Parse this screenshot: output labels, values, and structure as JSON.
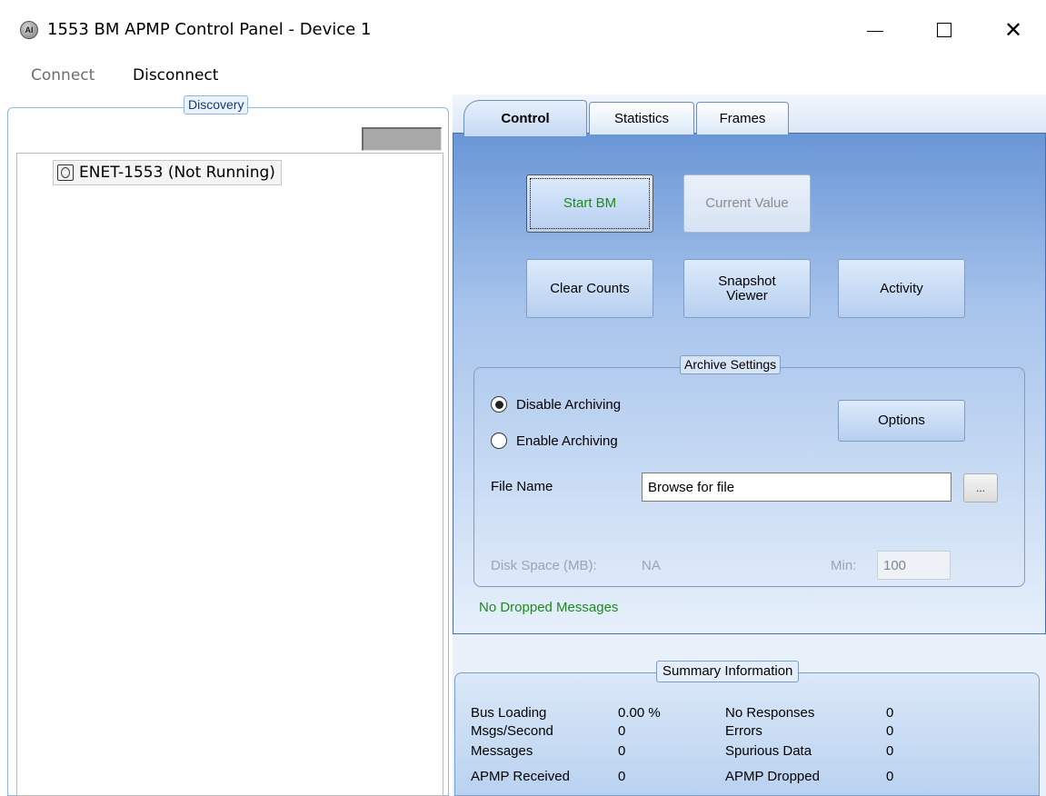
{
  "window": {
    "title": "1553 BM APMP Control Panel - Device 1",
    "icon_text": "AI"
  },
  "menu": {
    "connect": "Connect",
    "disconnect": "Disconnect"
  },
  "discovery": {
    "legend": "Discovery",
    "tree_items": [
      {
        "label": "ENET-1553 (Not Running)",
        "icon": "device-status-icon"
      }
    ]
  },
  "tabs": [
    {
      "label": "Control",
      "active": true
    },
    {
      "label": "Statistics",
      "active": false
    },
    {
      "label": "Frames",
      "active": false
    }
  ],
  "control": {
    "start_bm": "Start BM",
    "current_value": "Current Value",
    "clear_counts": "Clear Counts",
    "snapshot_viewer": "Snapshot Viewer",
    "activity": "Activity",
    "archive": {
      "legend": "Archive Settings",
      "disable_label": "Disable Archiving",
      "enable_label": "Enable Archiving",
      "selected": "Disable Archiving",
      "options": "Options",
      "file_name_label": "File Name",
      "file_name_value": "Browse for file",
      "browse": "...",
      "disk_space_label": "Disk Space (MB):",
      "disk_space_value": "NA",
      "min_label": "Min:",
      "min_value": "100"
    },
    "status": "No Dropped Messages"
  },
  "summary": {
    "legend": "Summary Information",
    "left": [
      {
        "label": "Bus Loading",
        "value": "0.00 %"
      },
      {
        "label": "Msgs/Second",
        "value": "0"
      },
      {
        "label": "Messages",
        "value": "0"
      },
      {
        "label": "APMP Received",
        "value": "0"
      }
    ],
    "right": [
      {
        "label": "No Responses",
        "value": "0"
      },
      {
        "label": "Errors",
        "value": "0"
      },
      {
        "label": "Spurious Data",
        "value": "0"
      },
      {
        "label": "APMP Dropped",
        "value": "0"
      }
    ]
  },
  "colors": {
    "status_green": "#1e8a1e",
    "group_border": "#7d9dc9",
    "panel_gradient_top": "#6a96d6"
  }
}
